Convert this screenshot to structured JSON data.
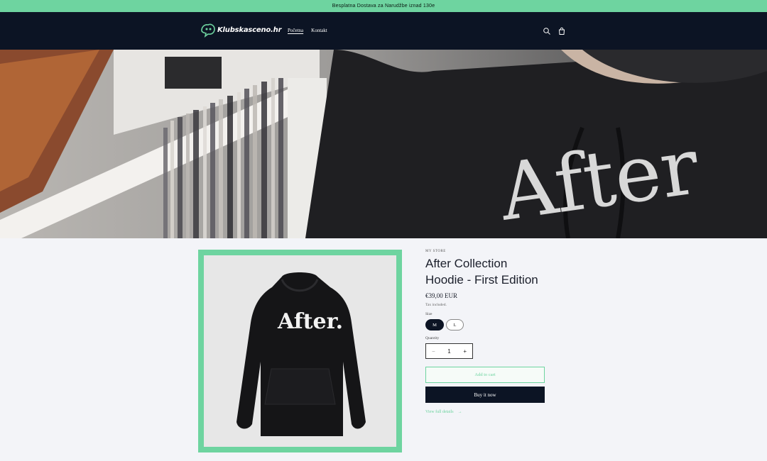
{
  "announcement": "Besplatna Dostava za Narudžbe iznad 130e",
  "header": {
    "logo_text": "Klubskasceno.hr",
    "nav": [
      {
        "label": "Početna",
        "active": true
      },
      {
        "label": "Kontakt",
        "active": false
      }
    ],
    "icons": [
      "search-icon",
      "cart-icon"
    ]
  },
  "hero": {
    "alt": "",
    "print_text": "After"
  },
  "product": {
    "image_print": "After.",
    "vendor": "MY STORE",
    "title_line1": "After Collection",
    "title_line2": "Hoodie - First Edition",
    "price": "€39,00 EUR",
    "tax_note": "Tax included.",
    "size_label": "Size",
    "sizes": [
      {
        "label": "M",
        "selected": true
      },
      {
        "label": "L",
        "selected": false
      }
    ],
    "quantity_label": "Quantity",
    "quantity_value": "1",
    "qty_minus": "−",
    "qty_plus": "+",
    "add_to_cart": "Add to cart",
    "buy_now": "Buy it now",
    "view_details": "View full details",
    "view_details_arrow": "→"
  },
  "colors": {
    "accent": "#6ed4a0",
    "header_bg": "#0c1424"
  }
}
